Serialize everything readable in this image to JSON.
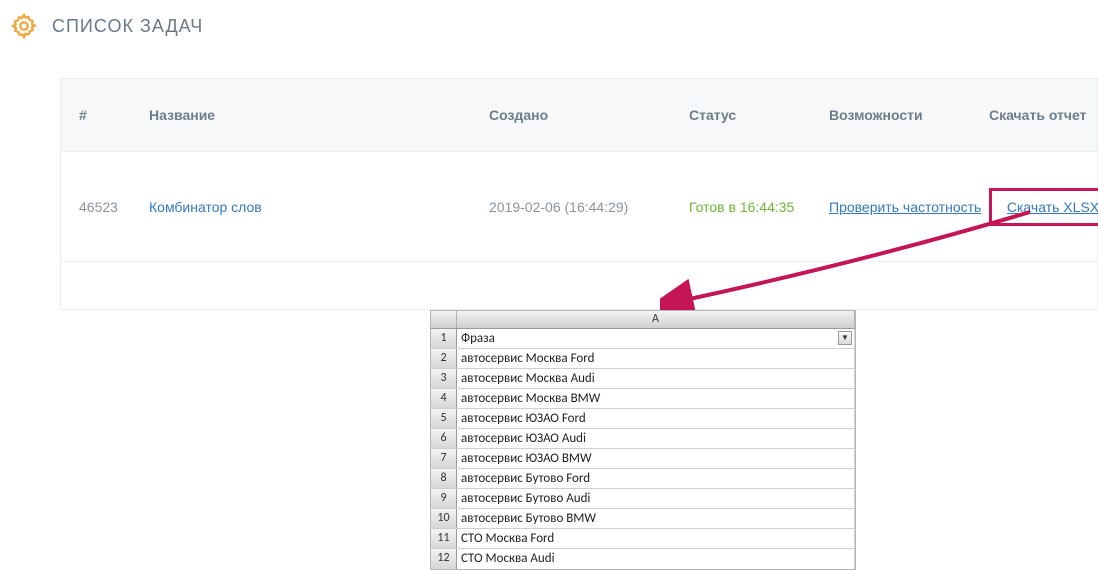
{
  "header": {
    "title": "СПИСОК ЗАДАЧ"
  },
  "table": {
    "columns": {
      "id": "#",
      "name": "Название",
      "created": "Создано",
      "status": "Статус",
      "actions": "Возможности",
      "download": "Скачать отчет"
    },
    "row": {
      "id": "46523",
      "name": "Комбинатор слов",
      "created": "2019-02-06 (16:44:29)",
      "status": "Готов в 16:44:35",
      "check_link": "Проверить частотность",
      "download_link": "Скачать XLSX"
    }
  },
  "spreadsheet": {
    "col_label": "A",
    "header_cell": "Фраза",
    "rows": [
      "автосервис Москва Ford",
      "автосервис Москва Audi",
      "автосервис Москва BMW",
      "автосервис ЮЗАО Ford",
      "автосервис ЮЗАО Audi",
      "автосервис ЮЗАО BMW",
      "автосервис Бутово Ford",
      "автосервис Бутово Audi",
      "автосервис Бутово BMW",
      "СТО Москва Ford",
      "СТО Москва Audi"
    ]
  }
}
